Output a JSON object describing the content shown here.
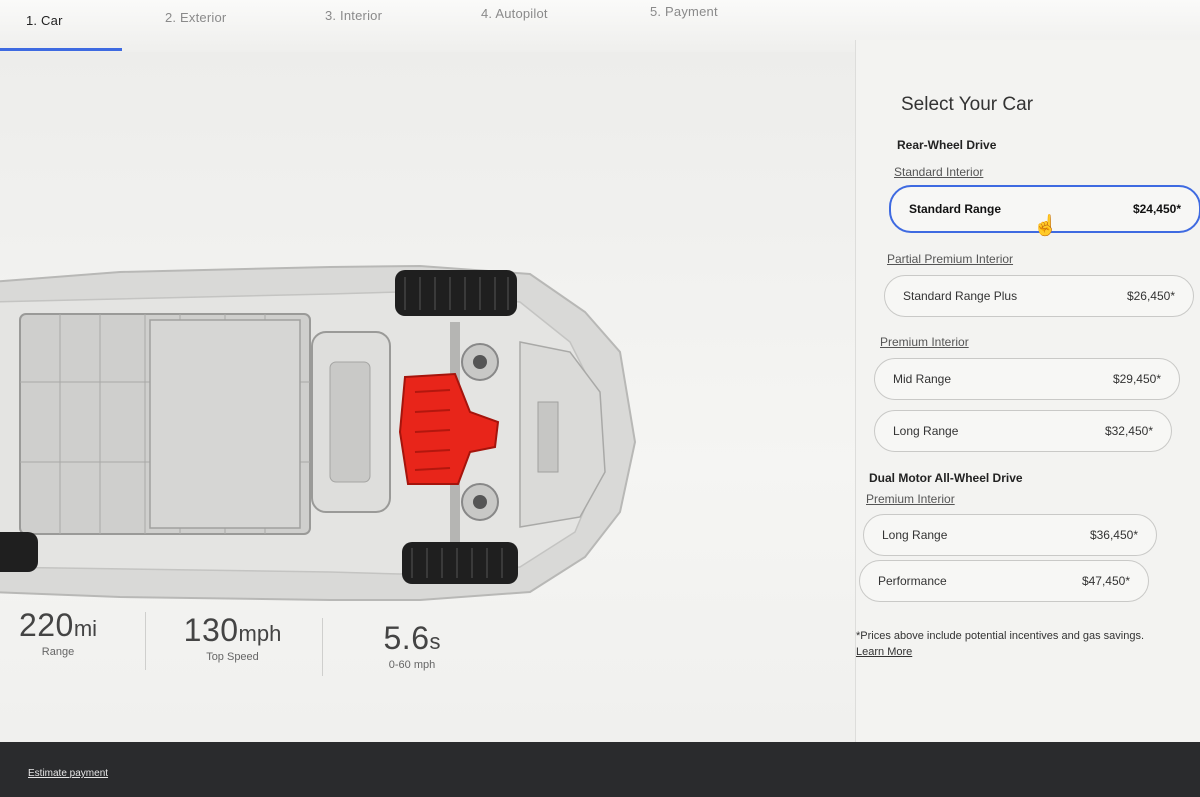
{
  "steps": [
    {
      "label": "1. Car"
    },
    {
      "label": "2. Exterior"
    },
    {
      "label": "3. Interior"
    },
    {
      "label": "4. Autopilot"
    },
    {
      "label": "5. Payment"
    }
  ],
  "panel": {
    "title": "Select Your Car",
    "groups": [
      {
        "title": "Rear-Wheel Drive"
      },
      {
        "title": "Dual Motor All-Wheel Drive"
      }
    ],
    "interiors": [
      {
        "label": "Standard Interior"
      },
      {
        "label": "Partial Premium Interior"
      },
      {
        "label": "Premium Interior"
      },
      {
        "label": "Premium Interior"
      }
    ],
    "options": [
      {
        "name": "Standard Range",
        "price": "$24,450*"
      },
      {
        "name": "Standard Range Plus",
        "price": "$26,450*"
      },
      {
        "name": "Mid Range",
        "price": "$29,450*"
      },
      {
        "name": "Long Range",
        "price": "$32,450*"
      },
      {
        "name": "Long Range",
        "price": "$36,450*"
      },
      {
        "name": "Performance",
        "price": "$47,450*"
      }
    ],
    "note": "*Prices above include potential incentives and gas savings.",
    "learn_more": "Learn More"
  },
  "specs": [
    {
      "value": "220",
      "unit": "mi",
      "label": "Range"
    },
    {
      "value": "130",
      "unit": "mph",
      "label": "Top Speed"
    },
    {
      "value": "5.6",
      "unit": "s",
      "label": "0-60 mph"
    }
  ],
  "footer": {
    "estimate": "Estimate payment"
  },
  "colors": {
    "accent": "#3e6ae1",
    "motor": "#e8251a"
  }
}
